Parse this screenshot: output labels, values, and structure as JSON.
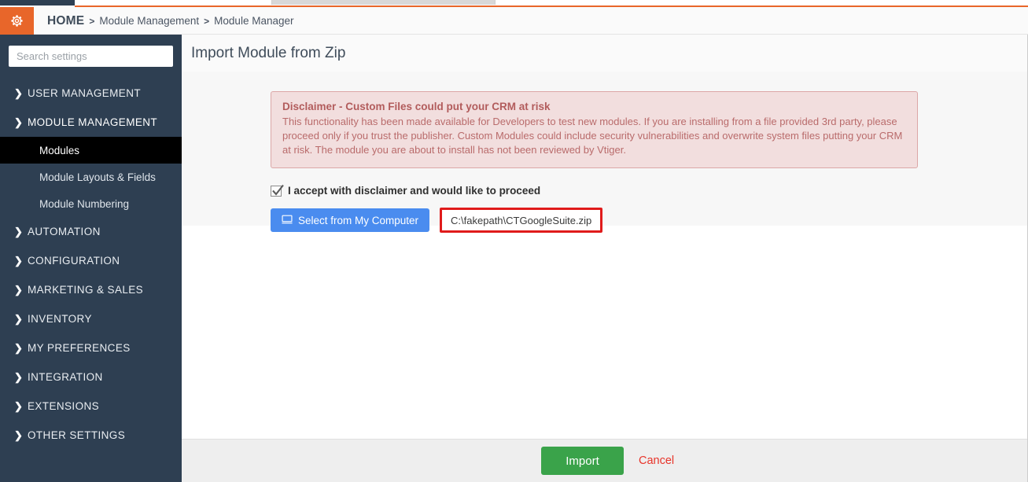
{
  "window": {
    "accent_orange": "#e8662a",
    "sidebar_bg": "#2e3f52"
  },
  "header": {
    "gear_icon": "gear-icon",
    "breadcrumb": {
      "home": "HOME",
      "separator": ">",
      "items": [
        {
          "label": "Module Management"
        },
        {
          "label": "Module Manager"
        }
      ]
    }
  },
  "sidebar": {
    "search": {
      "placeholder": "Search settings",
      "value": ""
    },
    "groups": [
      {
        "label": "USER MANAGEMENT",
        "icon": "chevron-right-icon",
        "expanded": false
      },
      {
        "label": "MODULE MANAGEMENT",
        "icon": "chevron-down-icon",
        "expanded": true
      },
      {
        "label": "AUTOMATION",
        "icon": "chevron-right-icon",
        "expanded": false
      },
      {
        "label": "CONFIGURATION",
        "icon": "chevron-right-icon",
        "expanded": false
      },
      {
        "label": "MARKETING & SALES",
        "icon": "chevron-right-icon",
        "expanded": false
      },
      {
        "label": "INVENTORY",
        "icon": "chevron-right-icon",
        "expanded": false
      },
      {
        "label": "MY PREFERENCES",
        "icon": "chevron-right-icon",
        "expanded": false
      },
      {
        "label": "INTEGRATION",
        "icon": "chevron-right-icon",
        "expanded": false
      },
      {
        "label": "EXTENSIONS",
        "icon": "chevron-right-icon",
        "expanded": false
      },
      {
        "label": "OTHER SETTINGS",
        "icon": "chevron-right-icon",
        "expanded": false
      }
    ],
    "sub_items": [
      {
        "label": "Modules",
        "active": true
      },
      {
        "label": "Module Layouts & Fields",
        "active": false
      },
      {
        "label": "Module Numbering",
        "active": false
      }
    ]
  },
  "main": {
    "page_title": "Import Module from Zip",
    "disclaimer": {
      "title": "Disclaimer - Custom Files could put your CRM at risk",
      "body": "This functionality has been made available for Developers to test new modules. If you are installing from a file provided 3rd party, please proceed only if you trust the publisher. Custom Modules could include security vulnerabilities and overwrite system files putting your CRM at risk. The module you are about to install has not been reviewed by Vtiger.",
      "bg_color": "#f2dede",
      "border_color": "#dca7a7",
      "text_color": "#b96b6b"
    },
    "accept": {
      "label": "I accept with disclaimer and would like to proceed",
      "checked": true
    },
    "file_select": {
      "button_label": "Select from My Computer",
      "button_icon": "monitor-icon",
      "button_color": "#4a8cef",
      "file_name": "C:\\fakepath\\CTGoogleSuite.zip",
      "highlight_border_color": "#e01b1b"
    }
  },
  "footer": {
    "import_label": "Import",
    "import_color": "#3aa34a",
    "cancel_label": "Cancel",
    "cancel_color": "#e8342a"
  }
}
